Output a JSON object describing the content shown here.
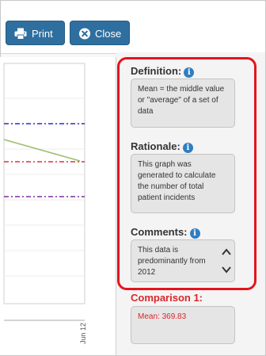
{
  "toolbar": {
    "print_label": "Print",
    "close_label": "Close",
    "print_icon": "printer-icon",
    "close_icon": "close-circle-icon"
  },
  "chart": {
    "x_tick_label": "Jun 12",
    "lines": [
      {
        "style": "dash-dot",
        "color": "#2b2bd1"
      },
      {
        "style": "solid",
        "color": "#9bbf6a"
      },
      {
        "style": "dash-dot",
        "color": "#e0303a"
      },
      {
        "style": "dash-dot",
        "color": "#7b2f9e"
      }
    ]
  },
  "definition": {
    "title": "Definition:",
    "text": "Mean = the middle value or \"average\" of a set of data"
  },
  "rationale": {
    "title": "Rationale:",
    "text": "This graph was generated to calculate the number of total patient incidents"
  },
  "comments": {
    "title": "Comments:",
    "text": "This data is predominantly from 2012"
  },
  "comparison": {
    "title": "Comparison 1:",
    "value_text": "Mean: 369.83"
  },
  "colors": {
    "button": "#2f6f9f",
    "highlight": "#e4141f",
    "comparison": "#d9262c",
    "info": "#2f7ec1"
  }
}
